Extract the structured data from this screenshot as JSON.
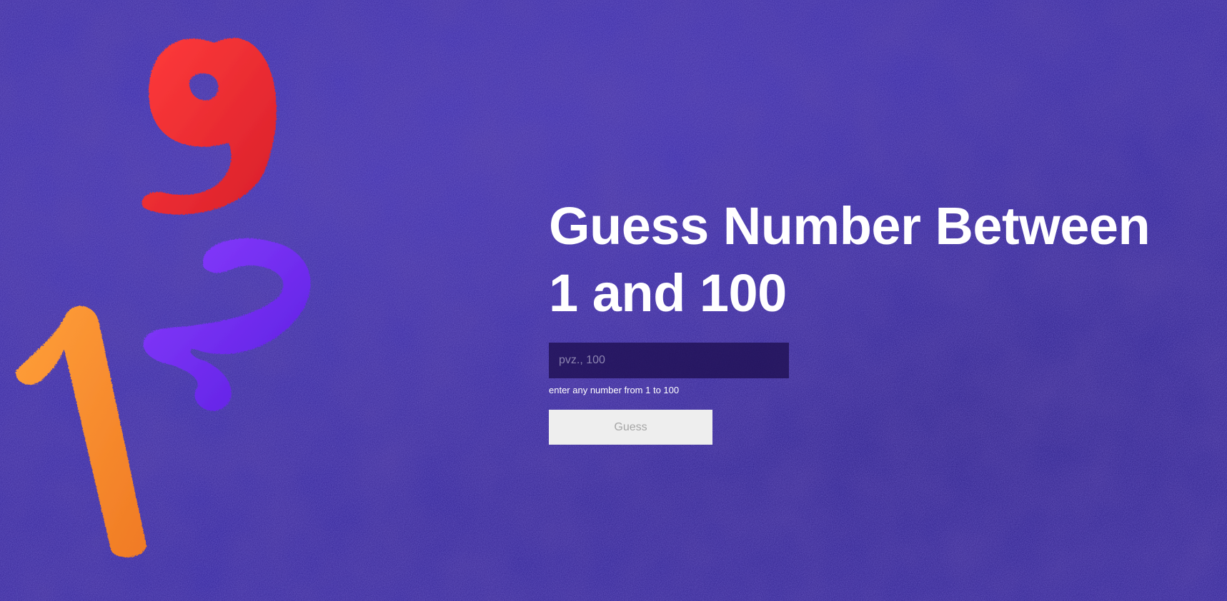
{
  "page": {
    "background_color": "#2f2199"
  },
  "decor": {
    "icons": [
      "yarn-number-9-icon",
      "yarn-number-2-icon",
      "yarn-number-1-icon"
    ],
    "colors": {
      "nine": "#ee2f2c",
      "two": "#7a2ef0",
      "one": "#f48a2e"
    }
  },
  "game": {
    "title": "Guess Number Between 1 and 100",
    "input_placeholder": "pvz., 100",
    "input_value": "",
    "hint": "enter any number from 1 to 100",
    "button_label": "Guess"
  }
}
